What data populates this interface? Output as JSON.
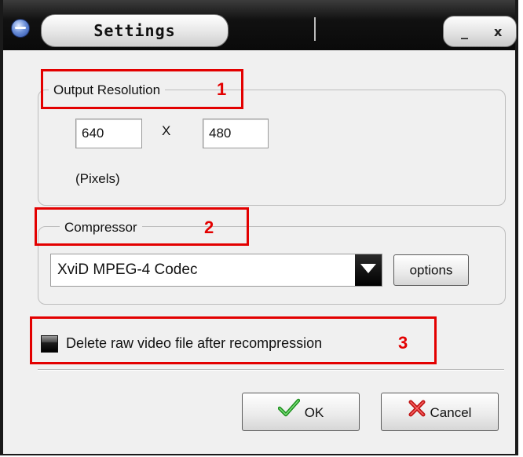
{
  "window": {
    "title": "Settings",
    "minimize_label": "_",
    "close_label": "x"
  },
  "resolution": {
    "legend": "Output Resolution",
    "width": "640",
    "separator": "X",
    "height": "480",
    "unit": "(Pixels)"
  },
  "compressor": {
    "legend": "Compressor",
    "selected": "XviD MPEG-4 Codec",
    "options_label": "options"
  },
  "delete_option": {
    "label": "Delete raw video file after recompression",
    "checked": false
  },
  "buttons": {
    "ok": "OK",
    "cancel": "Cancel"
  },
  "annotations": {
    "one": "1",
    "two": "2",
    "three": "3",
    "color": "#e30000"
  },
  "icons": {
    "title": "app-orb-icon",
    "ok": "checkmark-icon",
    "cancel": "cross-icon",
    "combo": "dropdown-arrow-icon"
  }
}
